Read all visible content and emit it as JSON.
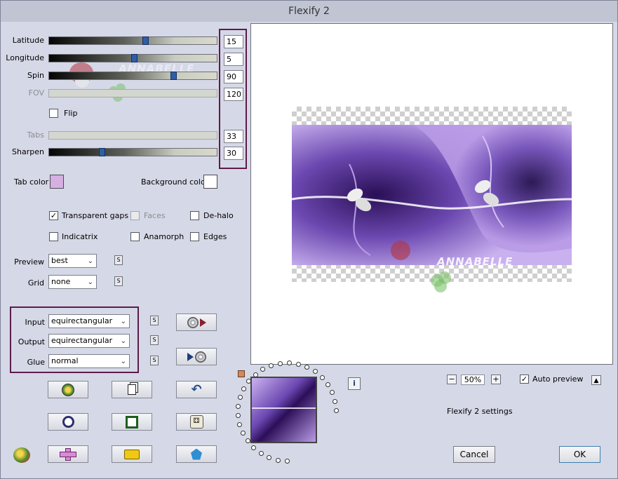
{
  "window": {
    "title": "Flexify 2"
  },
  "sliders": {
    "latitude": {
      "label": "Latitude",
      "value": "15",
      "level": 0.58
    },
    "longitude": {
      "label": "Longitude",
      "value": "5",
      "level": 0.51
    },
    "spin": {
      "label": "Spin",
      "value": "90",
      "level": 0.75
    },
    "fov": {
      "label": "FOV",
      "value": "120"
    },
    "tabs": {
      "label": "Tabs",
      "value": "33"
    },
    "sharpen": {
      "label": "Sharpen",
      "value": "30",
      "level": 0.31
    }
  },
  "flip": {
    "label": "Flip",
    "checked": false
  },
  "colors": {
    "tab_color_label": "Tab color",
    "tab_color": "#d7b0e2",
    "background_color_label": "Background color",
    "background_color": "#ffffff"
  },
  "options": {
    "transparent_gaps": {
      "label": "Transparent gaps",
      "checked": true
    },
    "faces": {
      "label": "Faces",
      "checked": false
    },
    "de_halo": {
      "label": "De-halo",
      "checked": false
    },
    "indicatrix": {
      "label": "Indicatrix",
      "checked": false
    },
    "anamorph": {
      "label": "Anamorph",
      "checked": false
    },
    "edges": {
      "label": "Edges",
      "checked": false
    }
  },
  "preview_setting": {
    "label": "Preview",
    "value": "best"
  },
  "grid_setting": {
    "label": "Grid",
    "value": "none"
  },
  "projection": {
    "input_label": "Input",
    "input_value": "equirectangular",
    "output_label": "Output",
    "output_value": "equirectangular",
    "glue_label": "Glue",
    "glue_value": "normal"
  },
  "small_s": "S",
  "zoom": {
    "minus": "−",
    "value": "50%",
    "plus": "+"
  },
  "auto_preview": {
    "label": "Auto preview",
    "checked": true
  },
  "settings_label": "Flexify 2 settings",
  "info_icon_text": "i",
  "buttons": {
    "cancel": "Cancel",
    "ok": "OK"
  },
  "watermark": "ANNABELLE",
  "accent": {
    "highlight": "#5d1b4c",
    "purple": "#6a4ba8",
    "thumb": "#2f5ea6"
  }
}
